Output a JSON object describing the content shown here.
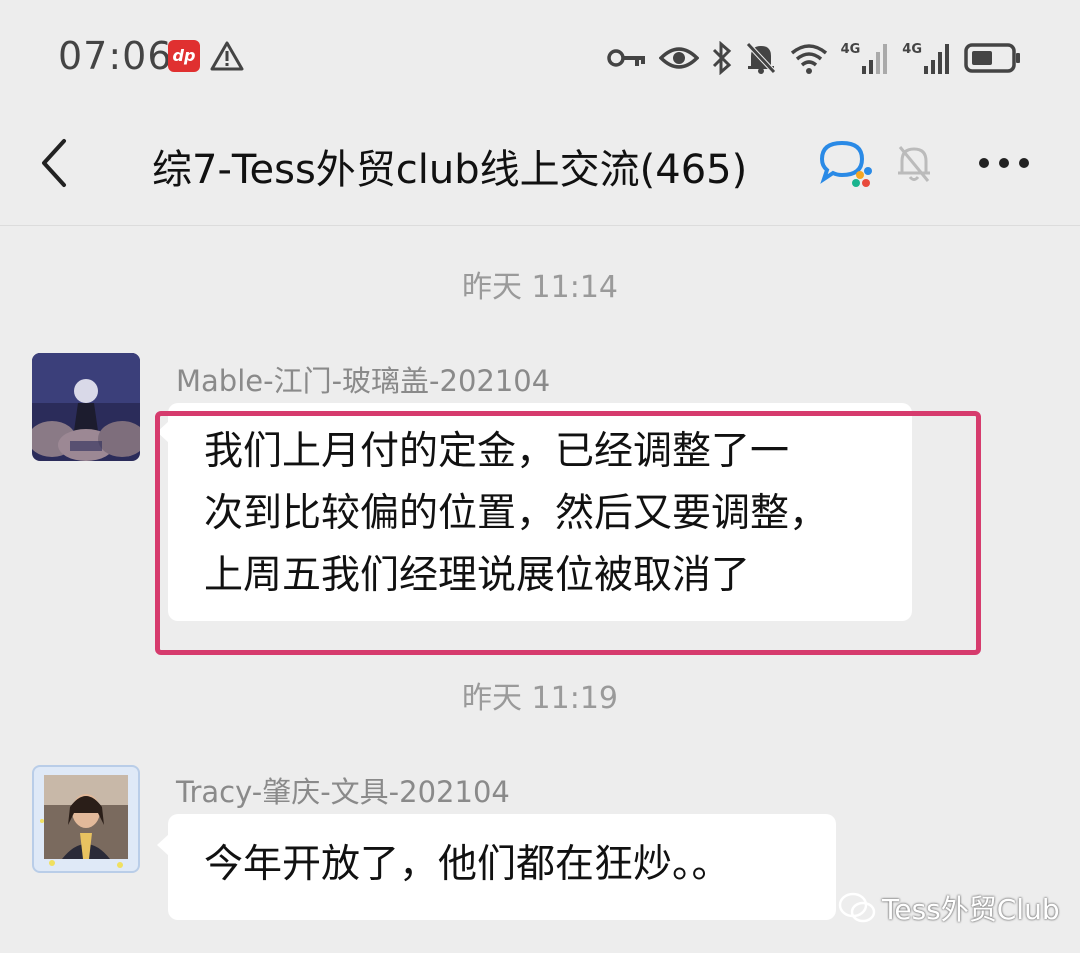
{
  "status_bar": {
    "time": "07:06",
    "app_badge": "dp",
    "net_1": "4G",
    "net_2": "4G"
  },
  "header": {
    "title": "综7-Tess外贸club线上交流(465)"
  },
  "messages": [
    {
      "timestamp": "昨天 11:14",
      "sender": "Mable-江门-玻璃盖-202104",
      "lines": [
        "我们上月付的定金，已经调整了一",
        "次到比较偏的位置，然后又要调整，",
        "上周五我们经理说展位被取消了"
      ]
    },
    {
      "timestamp": "昨天 11:19",
      "sender": "Tracy-肇庆-文具-202104",
      "lines": [
        "今年开放了，他们都在狂炒。。"
      ]
    }
  ],
  "watermark": {
    "text": "Tess外贸Club"
  },
  "colors": {
    "background": "#ededed",
    "highlight": "#d63b6d",
    "bubble": "#ffffff"
  }
}
